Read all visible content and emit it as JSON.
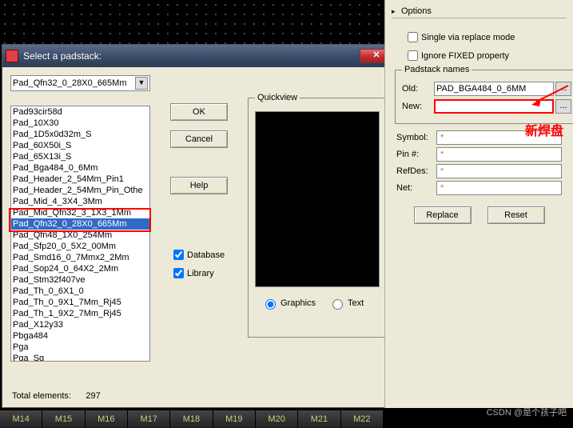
{
  "dialog": {
    "title": "Select a padstack:",
    "combo_value": "Pad_Qfn32_0_28X0_665Mm",
    "items": [
      "Pad93cir58d",
      "Pad_10X30",
      "Pad_1D5x0d32m_S",
      "Pad_60X50i_S",
      "Pad_65X13i_S",
      "Pad_Bga484_0_6Mm",
      "Pad_Header_2_54Mm_Pin1",
      "Pad_Header_2_54Mm_Pin_Othe",
      "Pad_Mid_4_3X4_3Mm",
      "Pad_Mid_Qfn32_3_1X3_1Mm",
      "Pad_Qfn32_0_28X0_665Mm",
      "Pad_Qfn48_1X0_254Mm",
      "Pad_Sfp20_0_5X2_00Mm",
      "Pad_Smd16_0_7Mmx2_2Mm",
      "Pad_Sop24_0_64X2_2Mm",
      "Pad_Stm32f407ve",
      "Pad_Th_0_6X1_0",
      "Pad_Th_0_9X1_7Mm_Rj45",
      "Pad_Th_1_9X2_7Mm_Rj45",
      "Pad_X12y33",
      "Pbga484",
      "Pga",
      "Pga_Sq"
    ],
    "selected_index": 10,
    "buttons": {
      "ok": "OK",
      "cancel": "Cancel",
      "help": "Help"
    },
    "checks": {
      "database": "Database",
      "library": "Library",
      "database_checked": true,
      "library_checked": true
    },
    "quickview": {
      "title": "Quickview",
      "graphics": "Graphics",
      "text": "Text",
      "mode": "graphics"
    },
    "totals_label": "Total elements:",
    "totals_value": "297"
  },
  "options": {
    "title": "Options",
    "single_via": "Single via replace mode",
    "ignore_fixed": "Ignore FIXED property",
    "padstack_group": "Padstack names",
    "old_label": "Old:",
    "old_value": "PAD_BGA484_0_6MM",
    "new_label": "New:",
    "new_value": "",
    "browse": "...",
    "symbol_label": "Symbol:",
    "pin_label": "Pin #:",
    "refdes_label": "RefDes:",
    "net_label": "Net:",
    "placeholder": "*",
    "replace_btn": "Replace",
    "reset_btn": "Reset"
  },
  "annotations": {
    "new_pad": "新焊盘"
  },
  "watermark": "CSDN @是个孩子吧",
  "strip": [
    "M14",
    "M15",
    "M16",
    "M17",
    "M18",
    "M19",
    "M20",
    "M21",
    "M22"
  ]
}
